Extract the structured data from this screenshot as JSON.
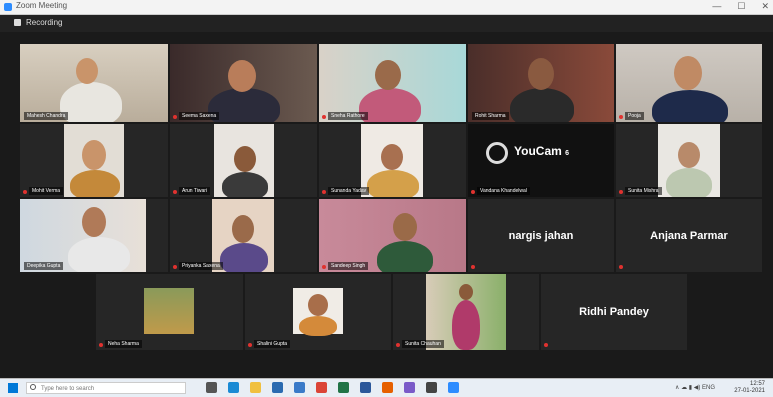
{
  "window": {
    "title": "Zoom Meeting",
    "controls": [
      "—",
      "☐",
      "✕"
    ]
  },
  "meeting_bar": {
    "label": "Recording"
  },
  "tiles": {
    "r1": [
      {
        "name": "Mahesh Chandra"
      },
      {
        "name": "Seema Saxena"
      },
      {
        "name": "Sneha Rathore"
      },
      {
        "name": "Rohit Sharma"
      },
      {
        "name": "Pooja"
      }
    ],
    "r2": [
      {
        "name": "Mohit Verma"
      },
      {
        "name": "Arun Tiwari"
      },
      {
        "name": "Sunanda Yadav"
      },
      {
        "name": "Vandana Khandelwal"
      },
      {
        "name": "Sunita Mishra"
      }
    ],
    "r2_youcam": {
      "logo": "YouCam",
      "version": "6"
    },
    "r3": [
      {
        "name": "Deepika Gupta"
      },
      {
        "name": "Priyanka Saxena"
      },
      {
        "name": "Sandeep Singh"
      },
      {
        "name": "nargis jahan",
        "big": "nargis jahan"
      },
      {
        "name": "Anjana Parmar",
        "big": "Anjana Parmar"
      }
    ],
    "r4": [
      {
        "name": "Neha Sharma"
      },
      {
        "name": "Shalini Gupta"
      },
      {
        "name": "Sunita Chauhan"
      },
      {
        "name": "Ridhi Pandey",
        "big": "Ridhi Pandey"
      }
    ]
  },
  "taskbar": {
    "search_placeholder": "Type here to search",
    "time": "12:57",
    "date": "27-01-2021",
    "tray": "∧ ☁ ▮ ◀) ENG"
  }
}
